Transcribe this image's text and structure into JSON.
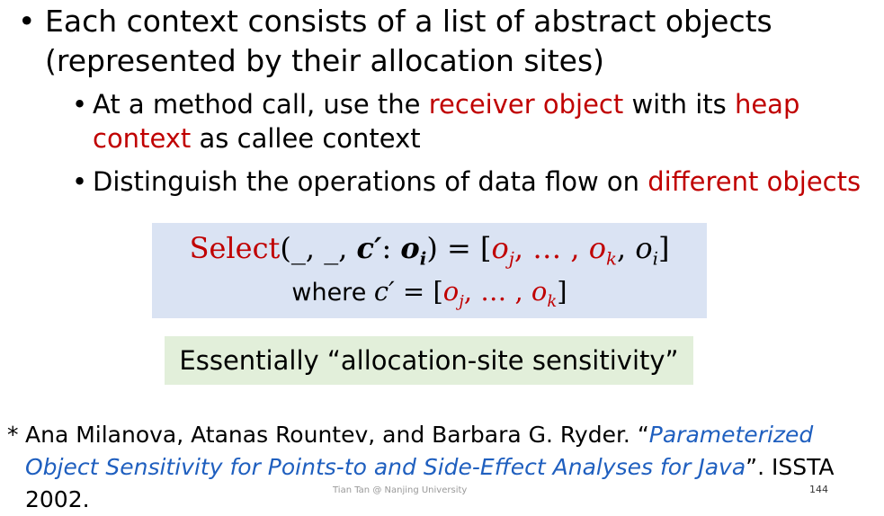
{
  "bullet1": {
    "marker": "•",
    "text": "Each context consists of a list of abstract objects (represented by their allocation sites)"
  },
  "bullet2": {
    "marker": "•",
    "pre": "At a method call, use the ",
    "red1": "receiver object",
    "mid": " with its ",
    "red2": "heap context",
    "post": " as callee context"
  },
  "bullet3": {
    "marker": "•",
    "pre": "Distinguish the operations of data flow on ",
    "red": "different objects"
  },
  "formula": {
    "select_word": "Select",
    "args_open": "(_, _, ",
    "c_prime": "c′",
    "colon": ": ",
    "o": "o",
    "i": "i",
    "args_close": ") = [",
    "oj_o": "o",
    "j": "j",
    "ellipsis": ", … , ",
    "ok_o": "o",
    "k": "k",
    "comma": ", ",
    "oi_o": "o",
    "oi_i": "i",
    "bracket_close": "]",
    "where_word": "where ",
    "c2": "c′",
    "eq2": " = [",
    "oj2_o": "o",
    "j2": "j",
    "ellipsis2": ", … , ",
    "ok2_o": "o",
    "k2": "k",
    "close2": "]"
  },
  "note": "Essentially “allocation-site sensitivity”",
  "reference": {
    "star": "*",
    "authors": "Ana Milanova, Atanas Rountev, and Barbara G. Ryder. “",
    "title": "Parameterized Object Sensitivity for Points-to and Side-Effect Analyses for Java",
    "venue": "”. ISSTA 2002."
  },
  "footer": "Tian Tan @ Nanjing University",
  "page_number": "144",
  "colors": {
    "accent_red": "#c00000",
    "link_blue": "#1f5fbf",
    "formula_bg": "#dae3f3",
    "note_bg": "#e2efda"
  }
}
